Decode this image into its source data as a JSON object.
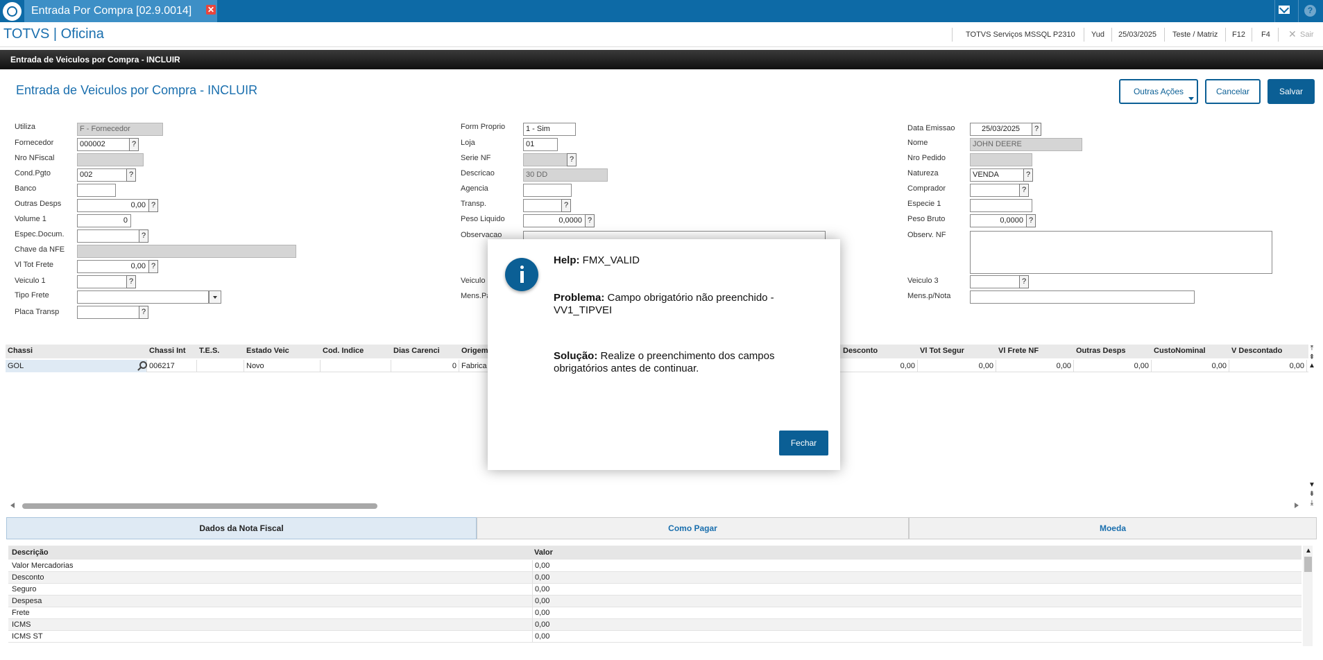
{
  "window": {
    "tab_title": "Entrada Por Compra [02.9.0014]",
    "tab_close": "✕"
  },
  "appbar": {
    "brand": "TOTVS | Oficina",
    "env": "TOTVS Serviços MSSQL P2310",
    "user": "Yud",
    "date": "25/03/2025",
    "company": "Teste / Matriz",
    "key_f12": "F12",
    "key_f4": "F4",
    "sair": "Sair"
  },
  "form_title_bar": "Entrada de Veiculos por Compra - INCLUIR",
  "page_title": "Entrada de Veiculos por Compra - INCLUIR",
  "actions": {
    "outras": "Outras Ações",
    "cancelar": "Cancelar",
    "salvar": "Salvar"
  },
  "labels": {
    "utiliza": "Utiliza",
    "fornecedor": "Fornecedor",
    "nro_nfiscal": "Nro NFiscal",
    "cond_pgto": "Cond.Pgto",
    "banco": "Banco",
    "outras_desps": "Outras Desps",
    "volume1": "Volume 1",
    "espec_docum": "Espec.Docum.",
    "chave_nfe": "Chave da NFE",
    "vl_tot_frete": "Vl Tot Frete",
    "veiculo1": "Veiculo 1",
    "tipo_frete": "Tipo Frete",
    "placa_transp": "Placa Transp",
    "form_proprio": "Form Proprio",
    "loja": "Loja",
    "serie_nf": "Serie NF",
    "descricao": "Descricao",
    "agencia": "Agencia",
    "transp": "Transp.",
    "peso_liquido": "Peso Liquido",
    "observacao": "Observacao",
    "veiculo2": "Veiculo",
    "mens_pa": "Mens.Pa",
    "data_emissao": "Data Emissao",
    "nome": "Nome",
    "nro_pedido": "Nro Pedido",
    "natureza": "Natureza",
    "comprador": "Comprador",
    "especie1": "Especie 1",
    "peso_bruto": "Peso Bruto",
    "observ_nf": "Observ. NF",
    "veiculo3": "Veiculo 3",
    "mens_p_nota": "Mens.p/Nota"
  },
  "values": {
    "utiliza": "F - Fornecedor",
    "fornecedor": "000002",
    "cond_pgto": "002",
    "outras_desps": "0,00",
    "volume1": "0",
    "vl_tot_frete": "0,00",
    "form_proprio": "1 - Sim",
    "loja": "01",
    "descricao": "30 DD",
    "peso_liquido": "0,0000",
    "data_emissao": "25/03/2025",
    "nome": "JOHN DEERE",
    "natureza": "VENDA",
    "peso_bruto": "0,0000",
    "help_q": "?"
  },
  "grid": {
    "headers": [
      "Chassi",
      "Chassi Int",
      "T.E.S.",
      "Estado Veic",
      "Cod. Indice",
      "Dias Carenci",
      "Origem",
      "Desconto",
      "Vl Tot Segur",
      "Vl Frete NF",
      "Outras Desps",
      "CustoNominal",
      "V Descontado"
    ],
    "row": [
      "GOL",
      "006217",
      "",
      "Novo",
      "",
      "0",
      "Fabrica",
      "0,00",
      "0,00",
      "0,00",
      "0,00",
      "0,00",
      "0,00"
    ]
  },
  "folders": [
    "Dados da Nota Fiscal",
    "Como Pagar",
    "Moeda"
  ],
  "nf_table": {
    "headers": [
      "Descrição",
      "Valor"
    ],
    "rows": [
      [
        "Valor Mercadorias",
        "0,00"
      ],
      [
        "Desconto",
        "0,00"
      ],
      [
        "Seguro",
        "0,00"
      ],
      [
        "Despesa",
        "0,00"
      ],
      [
        "Frete",
        "0,00"
      ],
      [
        "ICMS",
        "0,00"
      ],
      [
        "ICMS ST",
        "0,00"
      ]
    ]
  },
  "modal": {
    "help_label": "Help:",
    "help_value": "FMX_VALID",
    "problema_label": "Problema:",
    "problema_value": "Campo obrigatório não preenchido - VV1_TIPVEI",
    "solucao_label": "Solução:",
    "solucao_value": "Realize o preenchimento dos campos obrigatórios antes de continuar.",
    "fechar": "Fechar"
  },
  "colors": {
    "brand_blue": "#0b5f95",
    "topbar": "#0d6aa6",
    "tab_active": "#3d8fc6"
  }
}
